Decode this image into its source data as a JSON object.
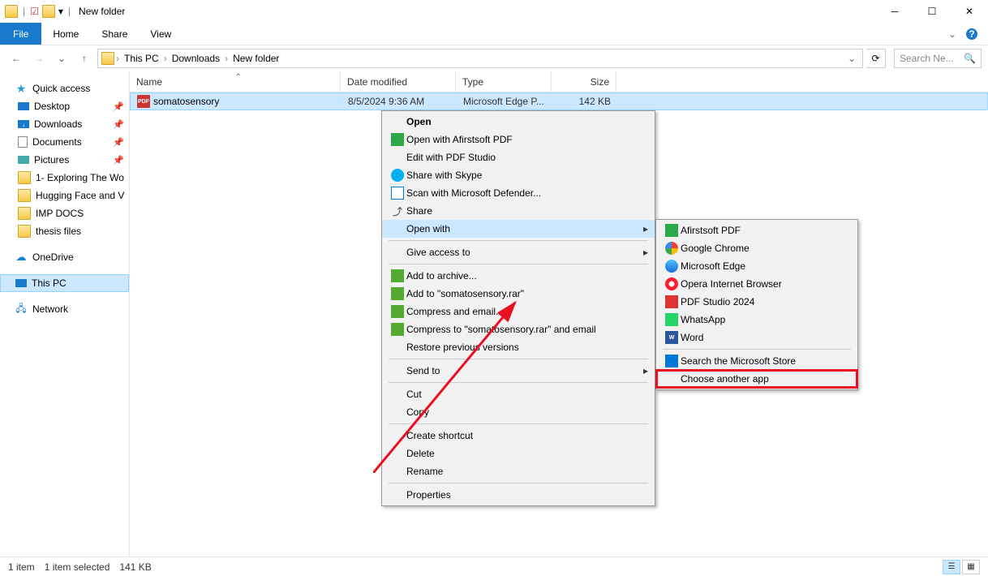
{
  "window": {
    "title": "New folder"
  },
  "qat": {
    "drop": "▾"
  },
  "ribbon": {
    "file": "File",
    "home": "Home",
    "share": "Share",
    "view": "View"
  },
  "breadcrumb": {
    "root": "This PC",
    "b1": "Downloads",
    "b2": "New folder"
  },
  "search": {
    "placeholder": "Search Ne..."
  },
  "sidebar": {
    "quick": "Quick access",
    "desktop": "Desktop",
    "downloads": "Downloads",
    "documents": "Documents",
    "pictures": "Pictures",
    "f1": "1- Exploring The Wo",
    "f2": "Hugging Face and V",
    "f3": "IMP DOCS",
    "f4": "thesis files",
    "onedrive": "OneDrive",
    "thispc": "This PC",
    "network": "Network"
  },
  "columns": {
    "name": "Name",
    "date": "Date modified",
    "type": "Type",
    "size": "Size"
  },
  "file": {
    "name": "somatosensory",
    "date": "8/5/2024 9:36 AM",
    "type": "Microsoft Edge P...",
    "size": "142 KB"
  },
  "context": {
    "open": "Open",
    "openAfirst": "Open with Afirstsoft PDF",
    "editPdfStudio": "Edit with PDF Studio",
    "skype": "Share with Skype",
    "defender": "Scan with Microsoft Defender...",
    "share": "Share",
    "openWith": "Open with",
    "giveAccess": "Give access to",
    "addArchive": "Add to archive...",
    "addRar": "Add to \"somatosensory.rar\"",
    "compressEmail": "Compress and email...",
    "compressRarEmail": "Compress to \"somatosensory.rar\" and email",
    "restore": "Restore previous versions",
    "sendTo": "Send to",
    "cut": "Cut",
    "copy": "Copy",
    "shortcut": "Create shortcut",
    "delete": "Delete",
    "rename": "Rename",
    "properties": "Properties"
  },
  "submenu": {
    "a": "Afirstsoft PDF",
    "chrome": "Google Chrome",
    "edge": "Microsoft Edge",
    "opera": "Opera Internet Browser",
    "pdfstudio": "PDF Studio 2024",
    "whatsapp": "WhatsApp",
    "word": "Word",
    "store": "Search the Microsoft Store",
    "choose": "Choose another app"
  },
  "status": {
    "items": "1 item",
    "selected": "1 item selected",
    "size": "141 KB"
  }
}
